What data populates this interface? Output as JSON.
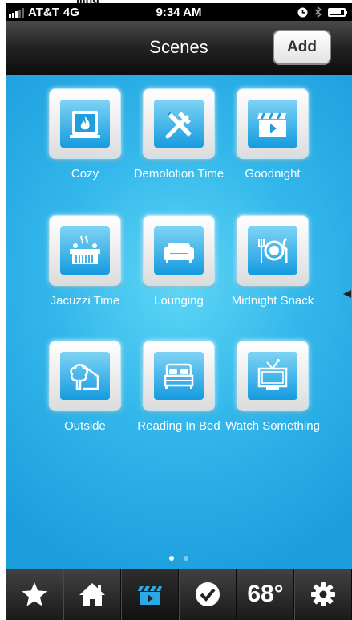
{
  "top_cut_text": "lling",
  "status": {
    "carrier": "AT&T",
    "network": "4G",
    "time": "9:34 AM",
    "battery_level": 0.8
  },
  "header": {
    "title": "Scenes",
    "add_label": "Add"
  },
  "scenes": [
    {
      "label": "Cozy",
      "icon": "fireplace-icon"
    },
    {
      "label": "Demolotion Time",
      "icon": "tools-icon"
    },
    {
      "label": "Goodnight",
      "icon": "clapperboard-icon"
    },
    {
      "label": "Jacuzzi Time",
      "icon": "hot-tub-icon"
    },
    {
      "label": "Lounging",
      "icon": "sofa-icon"
    },
    {
      "label": "Midnight Snack",
      "icon": "plate-utensils-icon"
    },
    {
      "label": "Outside",
      "icon": "tree-house-icon"
    },
    {
      "label": "Reading In Bed",
      "icon": "bed-icon"
    },
    {
      "label": "Watch Something",
      "icon": "tv-icon"
    }
  ],
  "pagination": {
    "pages": 2,
    "current": 1
  },
  "tabbar": {
    "temperature": "68°",
    "tabs": [
      "favorites-star-icon",
      "home-icon",
      "scenes-clapperboard-icon",
      "check-icon",
      "temperature",
      "settings-gear-icon"
    ],
    "active_tab": 2
  },
  "colors": {
    "accent_blue": "#2aa9e6",
    "navbar_dark": "#1e1e1e",
    "tab_icon": "#ffffff"
  }
}
